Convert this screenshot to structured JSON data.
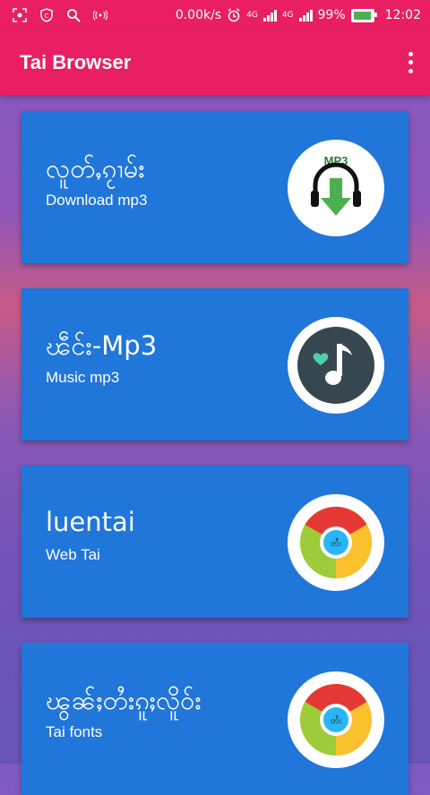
{
  "status": {
    "speed": "0.00k/s",
    "network1": "4G",
    "network2": "4G",
    "battery": "99%",
    "battery_level": 0.99,
    "time": "12:02"
  },
  "app": {
    "title": "Tai Browser"
  },
  "cards": [
    {
      "title": "လူတ်ႇၵႂၢမ်း",
      "subtitle": "Download mp3",
      "icon": "mp3-download-icon",
      "icon_text": "MP3"
    },
    {
      "title": "ၽဵင်း-Mp3",
      "subtitle": "Music mp3",
      "icon": "music-note-icon"
    },
    {
      "title": "luentai",
      "subtitle": "Web Tai",
      "icon": "tai-browser-icon",
      "icon_text": "တႆး"
    },
    {
      "title": "ၽွၼ်ႈတႆးၵူႈလိူဝ်း",
      "subtitle": "Tai fonts",
      "icon": "tai-browser-icon",
      "icon_text": "တႆး"
    }
  ],
  "colors": {
    "primary": "#e91e63",
    "card": "#2176d9",
    "accent_green": "#4caf50"
  }
}
